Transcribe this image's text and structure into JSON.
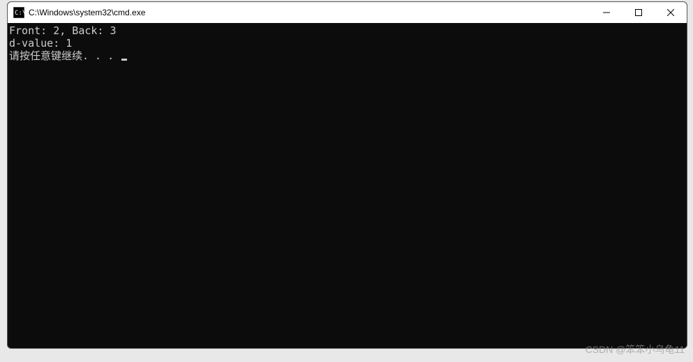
{
  "window": {
    "title": "C:\\Windows\\system32\\cmd.exe"
  },
  "console": {
    "line1": "Front: 2, Back: 3",
    "line2": "d-value: 1",
    "line3": "",
    "prompt": "请按任意键继续. . . "
  },
  "watermark": "CSDN @笨笨小乌龟11"
}
